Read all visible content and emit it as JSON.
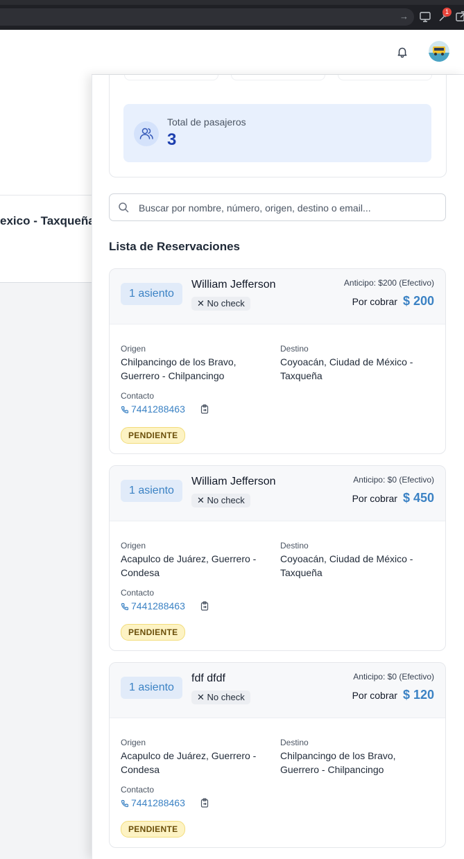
{
  "browser": {
    "notification_count": "1"
  },
  "background": {
    "route_text": "exico - Taxqueña"
  },
  "summary": {
    "passengers_label": "Total de pasajeros",
    "passengers_count": "3"
  },
  "search": {
    "placeholder": "Buscar por nombre, número, origen, destino o email..."
  },
  "list_title": "Lista de Reservaciones",
  "labels": {
    "origen": "Origen",
    "destino": "Destino",
    "contacto": "Contacto",
    "por_cobrar": "Por cobrar"
  },
  "reservations": [
    {
      "seats": "1 asiento",
      "name": "William Jefferson",
      "check": "No check",
      "anticipo": "Anticipo: $200 (Efectivo)",
      "amount": "$ 200",
      "origen": "Chilpancingo de los Bravo, Guerrero - Chilpancingo",
      "destino": "Coyoacán, Ciudad de México - Taxqueña",
      "phone": "7441288463",
      "status": "PENDIENTE"
    },
    {
      "seats": "1 asiento",
      "name": "William Jefferson",
      "check": "No check",
      "anticipo": "Anticipo: $0 (Efectivo)",
      "amount": "$ 450",
      "origen": "Acapulco de Juárez, Guerrero - Condesa",
      "destino": "Coyoacán, Ciudad de México - Taxqueña",
      "phone": "7441288463",
      "status": "PENDIENTE"
    },
    {
      "seats": "1 asiento",
      "name": "fdf dfdf",
      "check": "No check",
      "anticipo": "Anticipo: $0 (Efectivo)",
      "amount": "$ 120",
      "origen": "Acapulco de Juárez, Guerrero - Condesa",
      "destino": "Chilpancingo de los Bravo, Guerrero - Chilpancingo",
      "phone": "7441288463",
      "status": "PENDIENTE"
    }
  ]
}
